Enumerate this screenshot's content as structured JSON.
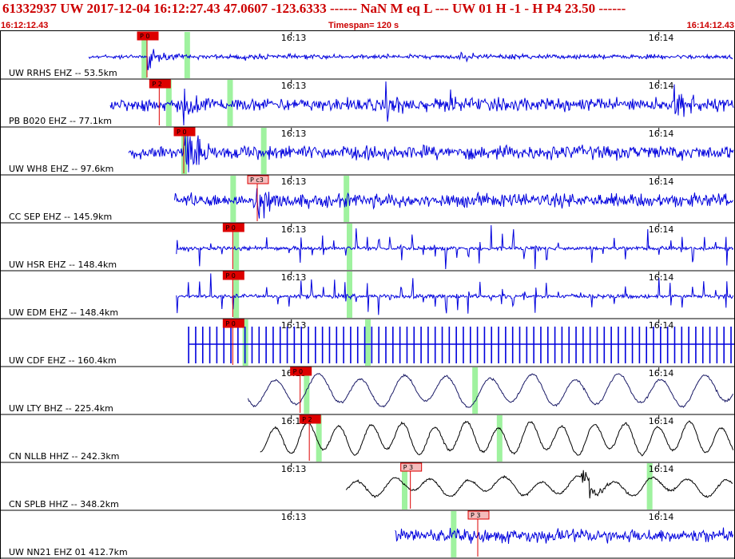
{
  "header": {
    "event_line": "61332937 UW 2017-12-04 16:12:27.43    47.0607 -123.6333 ------    NaN M    eq  L ---      UW 01  H  -1  -  H P4   23.50 ------",
    "start_time": "16:12:12.43",
    "timespan": "Timespan= 120 s",
    "end_time": "16:14:12.43"
  },
  "colors": {
    "trace_blue": "#0000dd",
    "trace_navy": "#1a1a66",
    "trace_black": "#000000",
    "pick_red": "#dd0000",
    "pick_pink": "#f4bcbc",
    "window_green": "#9ff29f",
    "header_red": "#cc0000"
  },
  "chart_data": {
    "type": "line",
    "time_start_s": 0,
    "time_end_s": 120,
    "minute_ticks": [
      {
        "label": "16:13",
        "t": 47.57
      },
      {
        "label": "16:14",
        "t": 107.57
      }
    ],
    "series": [
      {
        "name": "UW RRHS EHZ -- 53.5km",
        "color": "trace_blue",
        "style": "spiky",
        "data_start_s": 14.5,
        "pick": {
          "label": "P 0",
          "t": 24.0,
          "solid": true
        },
        "green_windows": [
          23.5,
          30.5
        ],
        "events": [
          {
            "t": 24.2,
            "amp": 0.9
          },
          {
            "t": 39.5,
            "amp": 0.3
          },
          {
            "t": 75.0,
            "amp": 0.4
          },
          {
            "t": 83.0,
            "amp": 0.25
          }
        ]
      },
      {
        "name": "PB B020 EHZ -- 77.1km",
        "color": "trace_blue",
        "style": "bursty",
        "data_start_s": 18.0,
        "pick": {
          "label": "P 2",
          "t": 26.0,
          "solid": true
        },
        "green_windows": [
          27.5,
          37.5
        ],
        "events": [
          {
            "t": 30.0,
            "amp": 0.7
          },
          {
            "t": 63.0,
            "amp": 0.55
          },
          {
            "t": 73.0,
            "amp": 0.4
          },
          {
            "t": 110.0,
            "amp": 0.8
          }
        ]
      },
      {
        "name": "UW WH8 EHZ -- 97.6km",
        "color": "trace_blue",
        "style": "noisy",
        "data_start_s": 21.0,
        "pick": {
          "label": "P 0",
          "t": 30.0,
          "solid": true
        },
        "green_windows": [
          30.0,
          43.0
        ],
        "events": [
          {
            "t": 30.0,
            "amp": 1.0
          }
        ]
      },
      {
        "name": "CC SEP EHZ -- 145.9km",
        "color": "trace_blue",
        "style": "noisy",
        "data_start_s": 28.5,
        "pick": {
          "label": "P c3",
          "t": 42.0,
          "solid": false
        },
        "green_windows": [
          38.0,
          56.5
        ],
        "events": [
          {
            "t": 42.0,
            "amp": 0.6
          }
        ]
      },
      {
        "name": "UW HSR EHZ -- 148.4km",
        "color": "trace_blue",
        "style": "pulses",
        "data_start_s": 28.8,
        "pick": {
          "label": "P 0",
          "t": 38.0,
          "solid": true
        },
        "green_windows": [
          38.5,
          57.0
        ],
        "period_s": 1.83,
        "events": []
      },
      {
        "name": "UW EDM EHZ -- 148.4km",
        "color": "trace_blue",
        "style": "pulses",
        "data_start_s": 28.8,
        "pick": {
          "label": "P 0",
          "t": 38.0,
          "solid": true
        },
        "green_windows": [
          38.5,
          57.0
        ],
        "period_s": 1.83,
        "events": []
      },
      {
        "name": "UW CDF EHZ -- 160.4km",
        "color": "trace_blue",
        "style": "comb",
        "data_start_s": 30.8,
        "pick": {
          "label": "P 0",
          "t": 38.0,
          "solid": true
        },
        "green_windows": [
          40.0,
          60.0
        ],
        "period_s": 1.15,
        "events": []
      },
      {
        "name": "UW LTY BHZ -- 225.4km",
        "color": "trace_navy",
        "style": "wave",
        "data_start_s": 40.5,
        "pick": {
          "label": "P 0",
          "t": 49.0,
          "solid": true
        },
        "green_windows": [
          50.0,
          77.5
        ],
        "period_s": 7.0,
        "events": []
      },
      {
        "name": "CN NLLB HHZ -- 242.3km",
        "color": "trace_black",
        "style": "wave",
        "data_start_s": 42.5,
        "pick": {
          "label": "P 2",
          "t": 50.5,
          "solid": true
        },
        "green_windows": [
          52.0,
          81.5
        ],
        "period_s": 5.2,
        "events": []
      },
      {
        "name": "CN SPLB HHZ -- 348.2km",
        "color": "trace_black",
        "style": "wave_burst",
        "data_start_s": 56.5,
        "pick": {
          "label": "P 3",
          "t": 67.0,
          "solid": false
        },
        "green_windows": [
          66.0,
          106.0
        ],
        "period_s": 6.0,
        "events": [
          {
            "t": 95.0,
            "amp": 0.9
          }
        ]
      },
      {
        "name": "UW NN21 EHZ 01 412.7km",
        "color": "trace_blue",
        "style": "noisy",
        "data_start_s": 64.5,
        "pick": {
          "label": "P 3",
          "t": 78.0,
          "solid": false
        },
        "green_windows": [
          74.0
        ],
        "events": []
      }
    ]
  }
}
